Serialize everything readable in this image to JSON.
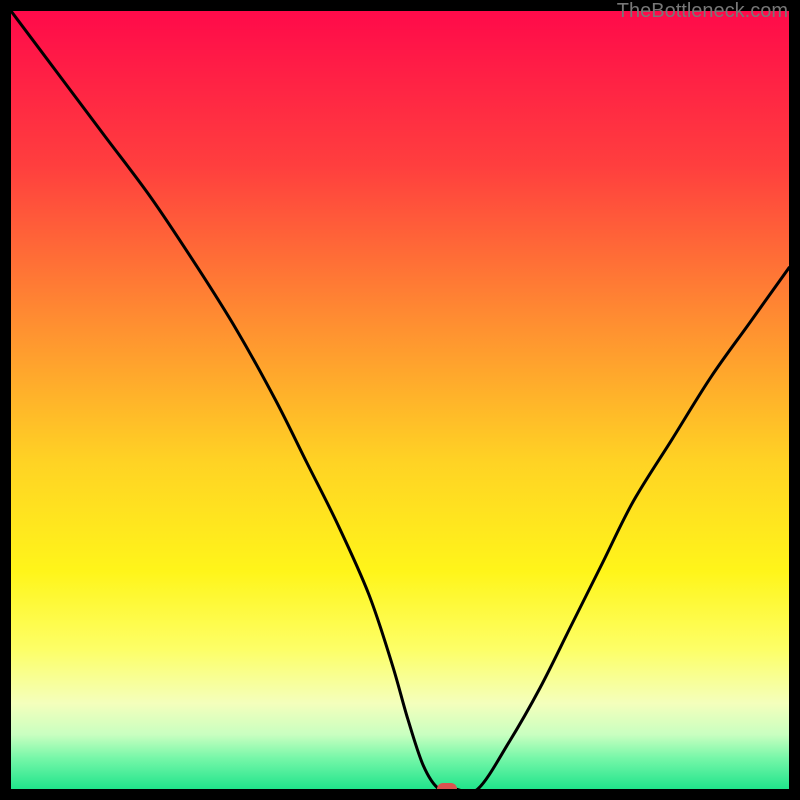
{
  "watermark": "TheBottleneck.com",
  "chart_data": {
    "type": "line",
    "title": "",
    "xlabel": "",
    "ylabel": "",
    "xlim": [
      0,
      100
    ],
    "ylim": [
      0,
      100
    ],
    "gradient_stops": [
      {
        "offset": 0,
        "color": "#ff0a4a"
      },
      {
        "offset": 20,
        "color": "#ff3f3e"
      },
      {
        "offset": 40,
        "color": "#ff8e31"
      },
      {
        "offset": 58,
        "color": "#ffd324"
      },
      {
        "offset": 72,
        "color": "#fff51a"
      },
      {
        "offset": 82,
        "color": "#fdff66"
      },
      {
        "offset": 89,
        "color": "#f4ffbc"
      },
      {
        "offset": 93,
        "color": "#c9ffc0"
      },
      {
        "offset": 96,
        "color": "#77f7a9"
      },
      {
        "offset": 100,
        "color": "#20e48b"
      }
    ],
    "series": [
      {
        "name": "bottleneck-curve",
        "x": [
          0,
          6,
          12,
          18,
          24,
          29,
          34,
          38,
          42,
          46,
          49,
          51,
          53,
          55,
          57,
          60,
          64,
          68,
          72,
          76,
          80,
          85,
          90,
          95,
          100
        ],
        "values": [
          100,
          92,
          84,
          76,
          67,
          59,
          50,
          42,
          34,
          25,
          16,
          9,
          3,
          0,
          0,
          0,
          6,
          13,
          21,
          29,
          37,
          45,
          53,
          60,
          67
        ]
      }
    ],
    "marker": {
      "x": 56,
      "y": 0
    }
  }
}
